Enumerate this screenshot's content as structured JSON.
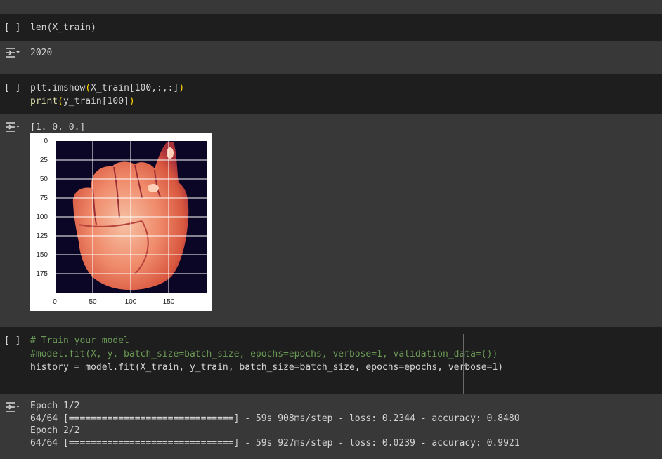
{
  "cells": [
    {
      "run_label": "[ ]",
      "code": "len(X_train)",
      "output": "2020"
    },
    {
      "run_label": "[ ]",
      "code_line1_fn": "plt.imshow",
      "code_line1_arg": "X_train[100,:,:]",
      "code_line2_fn": "print",
      "code_line2_arg": "y_train[100]",
      "output": "[1. 0. 0.]",
      "plot": {
        "yticks": [
          "0",
          "25",
          "50",
          "75",
          "100",
          "125",
          "150",
          "175"
        ],
        "xticks": [
          "0",
          "50",
          "100",
          "150"
        ]
      }
    },
    {
      "run_label": "[ ]",
      "comment1": "# Train your model",
      "comment2": "#model.fit(X, y, batch_size=batch_size, epochs=epochs, verbose=1, validation_data=())",
      "code3": "history = model.fit(X_train, y_train, batch_size=batch_size, epochs=epochs, verbose=1)",
      "output_lines": [
        "Epoch 1/2",
        "64/64 [==============================] - 59s 908ms/step - loss: 0.2344 - accuracy: 0.8480",
        "Epoch 2/2",
        "64/64 [==============================] - 59s 927ms/step - loss: 0.0239 - accuracy: 0.9921"
      ]
    }
  ],
  "icons": {
    "output_toggle": "output-collapse-icon",
    "run": "run-cell-button"
  }
}
